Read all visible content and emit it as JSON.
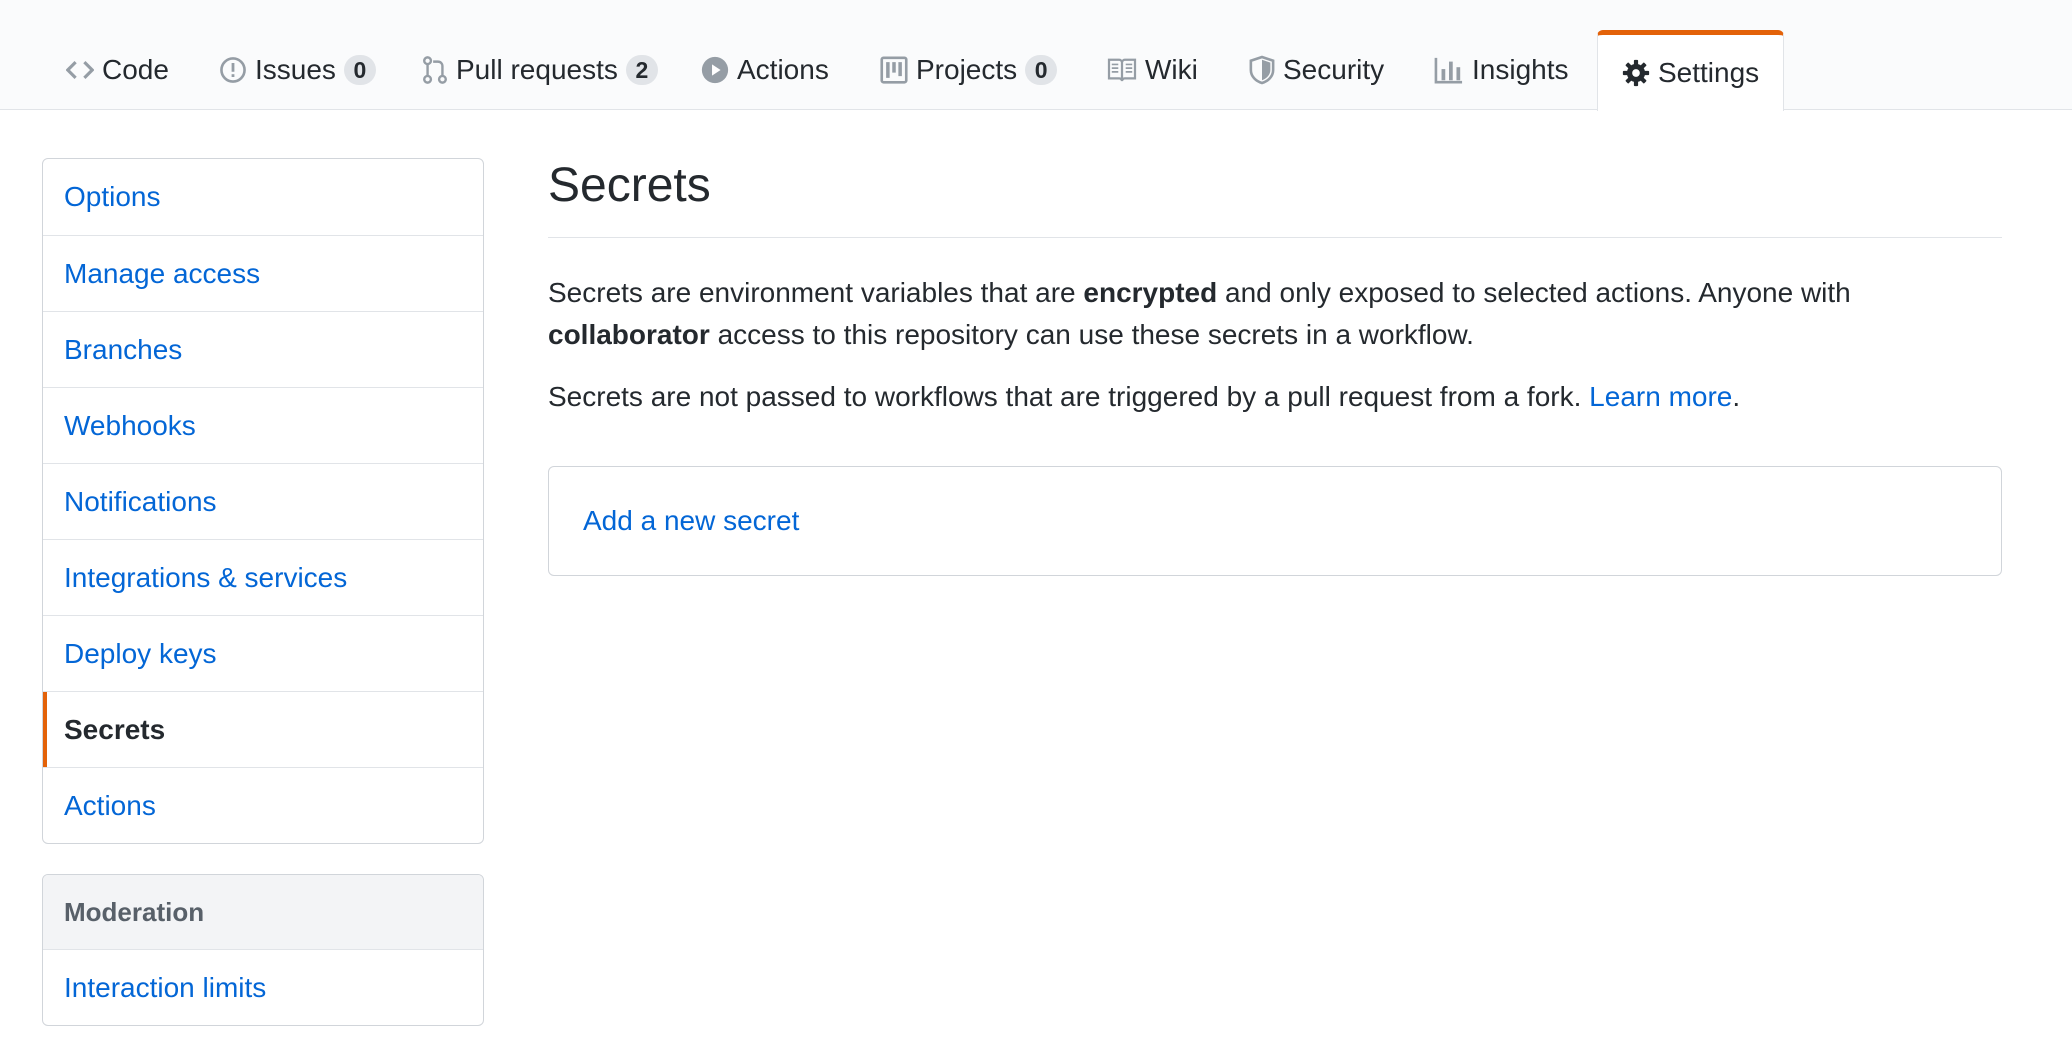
{
  "tabs": [
    {
      "label": "Code",
      "icon": "code-icon",
      "count": null
    },
    {
      "label": "Issues",
      "icon": "issue-icon",
      "count": "0"
    },
    {
      "label": "Pull requests",
      "icon": "pull-request-icon",
      "count": "2"
    },
    {
      "label": "Actions",
      "icon": "play-icon",
      "count": null
    },
    {
      "label": "Projects",
      "icon": "project-icon",
      "count": "0"
    },
    {
      "label": "Wiki",
      "icon": "book-icon",
      "count": null
    },
    {
      "label": "Security",
      "icon": "shield-icon",
      "count": null
    },
    {
      "label": "Insights",
      "icon": "graph-icon",
      "count": null
    },
    {
      "label": "Settings",
      "icon": "gear-icon",
      "count": null,
      "selected": true
    }
  ],
  "sidebar": {
    "items": [
      {
        "label": "Options"
      },
      {
        "label": "Manage access"
      },
      {
        "label": "Branches"
      },
      {
        "label": "Webhooks"
      },
      {
        "label": "Notifications"
      },
      {
        "label": "Integrations & services"
      },
      {
        "label": "Deploy keys"
      },
      {
        "label": "Secrets",
        "selected": true
      },
      {
        "label": "Actions"
      }
    ],
    "moderation": {
      "heading": "Moderation",
      "items": [
        {
          "label": "Interaction limits"
        }
      ]
    }
  },
  "main": {
    "title": "Secrets",
    "intro": {
      "part1": "Secrets are environment variables that are ",
      "bold1": "encrypted",
      "part2": " and only exposed to selected actions. Anyone with ",
      "bold2": "collaborator",
      "part3": " access to this repository can use these secrets in a workflow."
    },
    "fork_note": {
      "text": "Secrets are not passed to workflows that are triggered by a pull request from a fork. ",
      "link": "Learn more",
      "end": "."
    },
    "add_secret_label": "Add a new secret"
  },
  "colors": {
    "accent": "#e36209",
    "link": "#0366d6",
    "text": "#24292e",
    "muted": "#586069",
    "border": "#e1e4e8"
  }
}
